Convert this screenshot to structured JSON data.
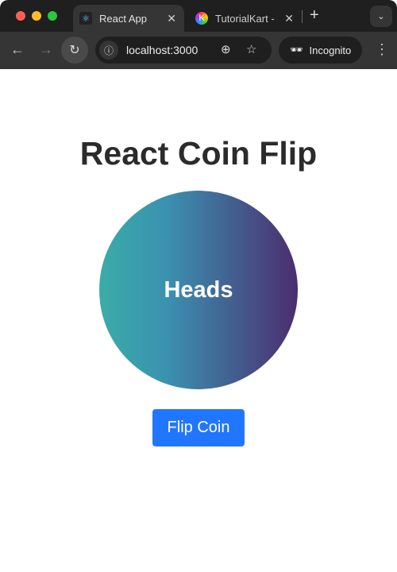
{
  "browser": {
    "tabs": [
      {
        "title": "React App",
        "icon": "react-icon",
        "active": true
      },
      {
        "title": "TutorialKart -",
        "icon": "tutorialkart-icon",
        "active": false
      }
    ],
    "url": "localhost:3000",
    "incognito_label": "Incognito"
  },
  "page": {
    "title": "React Coin Flip",
    "coin_face": "Heads",
    "flip_button": "Flip Coin"
  },
  "colors": {
    "button": "#2176ff",
    "coin_start": "#3aaca8",
    "coin_end": "#4b2d6e"
  }
}
